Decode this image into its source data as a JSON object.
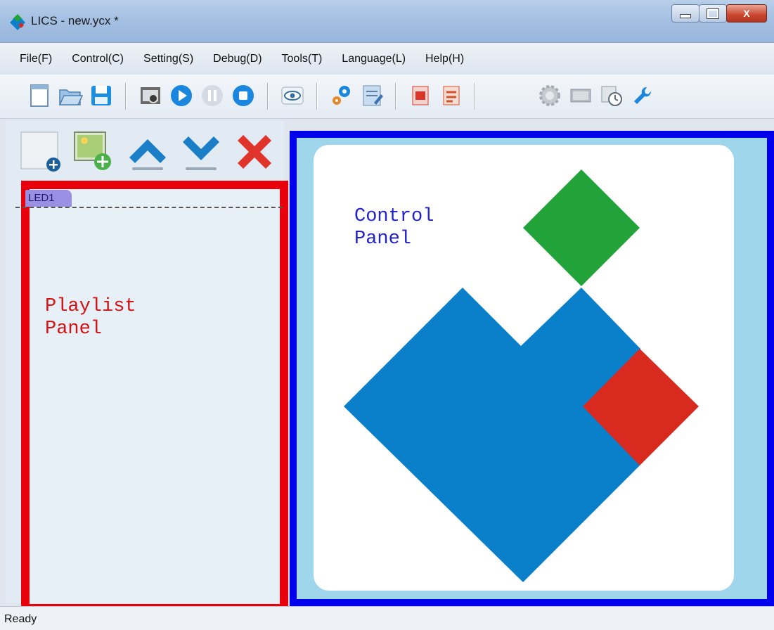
{
  "window": {
    "title": "LICS - new.ycx *",
    "controls": [
      "minimize",
      "maximize",
      "close"
    ],
    "close_glyph": "X"
  },
  "menu": [
    {
      "label": "File(F)"
    },
    {
      "label": "Control(C)"
    },
    {
      "label": "Setting(S)"
    },
    {
      "label": "Debug(D)"
    },
    {
      "label": "Tools(T)"
    },
    {
      "label": "Language(L)"
    },
    {
      "label": "Help(H)"
    }
  ],
  "toolbar": {
    "icons": [
      "new-file-icon",
      "open-folder-icon",
      "save-icon",
      "screen-capture-icon",
      "play-icon",
      "pause-icon",
      "stop-icon",
      "preview-eye-icon",
      "settings-gears-icon",
      "edit-document-icon",
      "program-red-icon",
      "schedule-red-icon",
      "brightness-gear-icon",
      "screen-icon",
      "timer-icon",
      "wrench-icon"
    ]
  },
  "playlist": {
    "buttons": [
      "add-screen-icon",
      "add-program-icon",
      "move-up-icon",
      "move-down-icon",
      "delete-icon"
    ],
    "tab_label": "LED1",
    "panel_label": "Playlist\nPanel"
  },
  "control": {
    "panel_label": "Control\nPanel",
    "shapes": {
      "green": "#22a33a",
      "blue": "#0a7fca",
      "red": "#d92a20"
    }
  },
  "colors": {
    "playlist_border": "#e8000b",
    "control_border": "#0000ee",
    "control_bg": "#9fd6ec"
  },
  "status": {
    "text": "Ready"
  }
}
